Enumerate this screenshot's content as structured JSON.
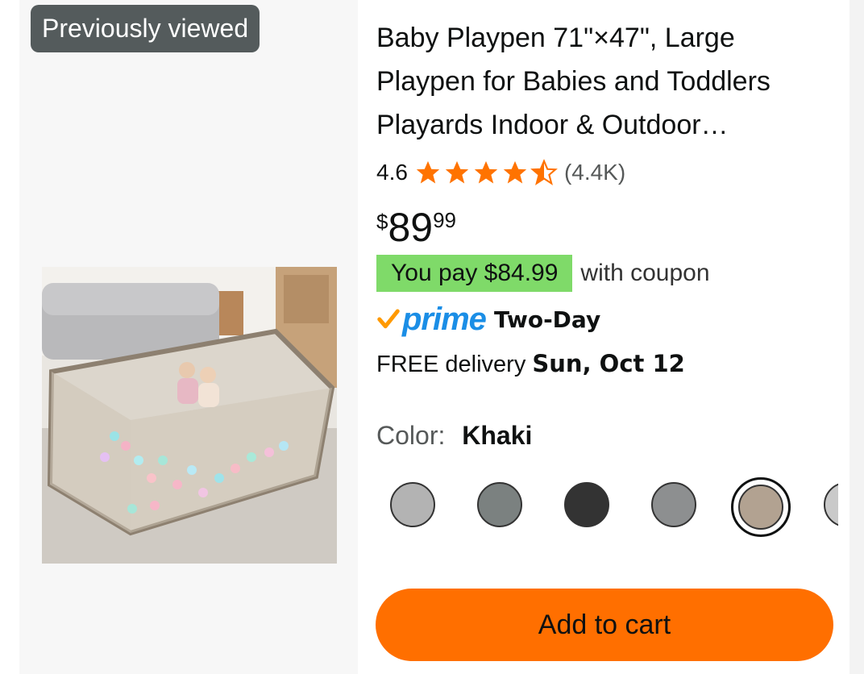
{
  "badge": {
    "label": "Previously viewed"
  },
  "product": {
    "image_alt": "Baby playpen with children and colorful balls",
    "title": "Baby Playpen 71\"×47\", Large Playpen for Babies and Toddlers Playards Indoor & Outdoor…",
    "rating": {
      "value": "4.6",
      "stars": 4.5,
      "count": "(4.4K)"
    },
    "price": {
      "currency": "$",
      "whole": "89",
      "fraction": "99"
    },
    "coupon": {
      "text": "You pay $84.99",
      "suffix": "with coupon"
    },
    "prime": {
      "word": "prime",
      "speed": "Two-Day"
    },
    "delivery": {
      "prefix": "FREE delivery",
      "date": "Sun, Oct 12"
    },
    "color": {
      "label": "Color:",
      "value": "Khaki"
    },
    "swatches": [
      {
        "name": "light-gray",
        "color": "#b3b3b3"
      },
      {
        "name": "gray",
        "color": "#7b8180"
      },
      {
        "name": "black",
        "color": "#333333"
      },
      {
        "name": "dark-gray",
        "color": "#8d8f90"
      },
      {
        "name": "khaki",
        "color": "#b2a291",
        "selected": true
      },
      {
        "name": "partial-gray",
        "color": "#c9c9c9"
      }
    ],
    "add_to_cart": "Add to cart"
  },
  "colors": {
    "accent_orange": "#ff6f00",
    "coupon_green": "#7fda69",
    "prime_blue": "#1b8ee6",
    "star_orange": "#ff7300"
  }
}
